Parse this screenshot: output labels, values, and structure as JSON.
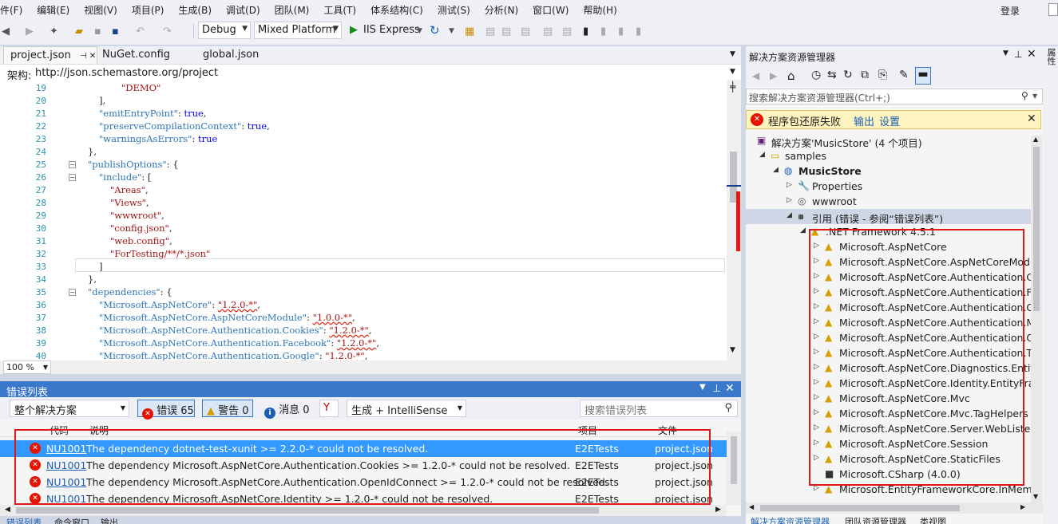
{
  "menu": [
    "件(F)",
    "编辑(E)",
    "视图(V)",
    "项目(P)",
    "生成(B)",
    "调试(D)",
    "团队(M)",
    "工具(T)",
    "体系结构(C)",
    "测试(S)",
    "分析(N)",
    "窗口(W)",
    "帮助(H)"
  ],
  "login": "登录",
  "toolbar": {
    "config": "Debug",
    "platform": "Mixed Platform",
    "run": "IIS Express"
  },
  "tabs": [
    {
      "label": "project.json",
      "active": true
    },
    {
      "label": "NuGet.config"
    },
    {
      "label": "global.json"
    }
  ],
  "schema": {
    "label": "架构:",
    "url": "http://json.schemastore.org/project"
  },
  "code_lines": [
    {
      "n": "19",
      "indent": 4,
      "parts": [
        [
          "s",
          "\"DEMO\""
        ]
      ]
    },
    {
      "n": "20",
      "indent": 2,
      "parts": [
        [
          "p",
          "],"
        ]
      ]
    },
    {
      "n": "21",
      "indent": 2,
      "parts": [
        [
          "k",
          "\"emitEntryPoint\""
        ],
        [
          "p",
          ": "
        ],
        [
          "kw",
          "true"
        ],
        [
          "p",
          ","
        ]
      ]
    },
    {
      "n": "22",
      "indent": 2,
      "parts": [
        [
          "k",
          "\"preserveCompilationContext\""
        ],
        [
          "p",
          ": "
        ],
        [
          "kw",
          "true"
        ],
        [
          "p",
          ","
        ]
      ]
    },
    {
      "n": "23",
      "indent": 2,
      "parts": [
        [
          "k",
          "\"warningsAsErrors\""
        ],
        [
          "p",
          ": "
        ],
        [
          "kw",
          "true"
        ]
      ]
    },
    {
      "n": "24",
      "indent": 1,
      "parts": [
        [
          "p",
          "},"
        ]
      ]
    },
    {
      "n": "25",
      "indent": 1,
      "fold": true,
      "parts": [
        [
          "k",
          "\"publishOptions\""
        ],
        [
          "p",
          ": {"
        ]
      ]
    },
    {
      "n": "26",
      "indent": 2,
      "fold": true,
      "parts": [
        [
          "k",
          "\"include\""
        ],
        [
          "p",
          ": ["
        ]
      ]
    },
    {
      "n": "27",
      "indent": 3,
      "parts": [
        [
          "s",
          "\"Areas\""
        ],
        [
          "p",
          ","
        ]
      ]
    },
    {
      "n": "28",
      "indent": 3,
      "parts": [
        [
          "s",
          "\"Views\""
        ],
        [
          "p",
          ","
        ]
      ]
    },
    {
      "n": "29",
      "indent": 3,
      "parts": [
        [
          "s",
          "\"wwwroot\""
        ],
        [
          "p",
          ","
        ]
      ]
    },
    {
      "n": "30",
      "indent": 3,
      "parts": [
        [
          "s",
          "\"config.json\""
        ],
        [
          "p",
          ","
        ]
      ]
    },
    {
      "n": "31",
      "indent": 3,
      "parts": [
        [
          "s",
          "\"web.config\""
        ],
        [
          "p",
          ","
        ]
      ]
    },
    {
      "n": "32",
      "indent": 3,
      "parts": [
        [
          "s",
          "\"ForTesting/**/*.json\""
        ]
      ]
    },
    {
      "n": "33",
      "indent": 2,
      "parts": [
        [
          "p",
          "]"
        ]
      ]
    },
    {
      "n": "34",
      "indent": 1,
      "parts": [
        [
          "p",
          "},"
        ]
      ]
    },
    {
      "n": "35",
      "indent": 1,
      "fold": true,
      "parts": [
        [
          "k",
          "\"dependencies\""
        ],
        [
          "p",
          ": {"
        ]
      ]
    },
    {
      "n": "36",
      "indent": 2,
      "parts": [
        [
          "k",
          "\"Microsoft.AspNetCore\""
        ],
        [
          "p",
          ": "
        ],
        [
          "sw",
          "\"1.2.0-*\""
        ],
        [
          "p",
          ","
        ]
      ]
    },
    {
      "n": "37",
      "indent": 2,
      "parts": [
        [
          "k",
          "\"Microsoft.AspNetCore.AspNetCoreModule\""
        ],
        [
          "p",
          ": "
        ],
        [
          "sw",
          "\"1.0.0-*\""
        ],
        [
          "p",
          ","
        ]
      ]
    },
    {
      "n": "38",
      "indent": 2,
      "parts": [
        [
          "k",
          "\"Microsoft.AspNetCore.Authentication.Cookies\""
        ],
        [
          "p",
          ": "
        ],
        [
          "sw",
          "\"1.2.0-*\""
        ],
        [
          "p",
          ","
        ]
      ]
    },
    {
      "n": "39",
      "indent": 2,
      "parts": [
        [
          "k",
          "\"Microsoft.AspNetCore.Authentication.Facebook\""
        ],
        [
          "p",
          ": "
        ],
        [
          "sw",
          "\"1.2.0-*\""
        ],
        [
          "p",
          ","
        ]
      ]
    },
    {
      "n": "40",
      "indent": 2,
      "parts": [
        [
          "k",
          "\"Microsoft.AspNetCore.Authentication.Google\""
        ],
        [
          "p",
          ": "
        ],
        [
          "sw",
          "\"1.2.0-*\""
        ],
        [
          "p",
          ","
        ]
      ]
    }
  ],
  "zoom": "100 %",
  "errors": {
    "title": "错误列表",
    "scope": "整个解决方案",
    "errors_btn": "错误 65",
    "warnings_btn": "警告 0",
    "messages_btn": "消息 0",
    "build_filter": "生成 + IntelliSense",
    "search_placeholder": "搜索错误列表",
    "cols": {
      "code": "代码",
      "desc": "说明",
      "project": "项目",
      "file": "文件"
    },
    "rows": [
      {
        "code": "NU1001",
        "desc": "The dependency dotnet-test-xunit >= 2.2.0-* could not be resolved.",
        "project": "E2ETests",
        "file": "project.json"
      },
      {
        "code": "NU1001",
        "desc": "The dependency Microsoft.AspNetCore.Authentication.Cookies >= 1.2.0-* could not be resolved.",
        "project": "E2ETests",
        "file": "project.json"
      },
      {
        "code": "NU1001",
        "desc": "The dependency Microsoft.AspNetCore.Authentication.OpenIdConnect >= 1.2.0-* could not be resolved.",
        "project": "E2ETests",
        "file": "project.json"
      },
      {
        "code": "NU1001",
        "desc": "The dependency Microsoft.AspNetCore.Identity >= 1.2.0-* could not be resolved.",
        "project": "E2ETests",
        "file": "project.json"
      }
    ],
    "bottom_tabs": [
      "错误列表",
      "命令窗口",
      "输出"
    ]
  },
  "solution": {
    "title": "解决方案资源管理器",
    "search_placeholder": "搜索解决方案资源管理器(Ctrl+;)",
    "warn_text": "程序包还原失败",
    "warn_output": "输出",
    "warn_settings": "设置",
    "tree": [
      {
        "label": "解决方案'MusicStore' (4 个项目)",
        "level": 0,
        "icon": "solution"
      },
      {
        "label": "samples",
        "level": 1,
        "arrow": "open",
        "icon": "folder"
      },
      {
        "label": "MusicStore",
        "level": 2,
        "arrow": "open",
        "icon": "project",
        "bold": true
      },
      {
        "label": "Properties",
        "level": 3,
        "arrow": "closed",
        "icon": "wrench"
      },
      {
        "label": "wwwroot",
        "level": 3,
        "arrow": "closed",
        "icon": "globe"
      },
      {
        "label": "引用 (错误 - 参阅“错误列表”)",
        "level": 3,
        "arrow": "open",
        "icon": "refs",
        "selected": true
      },
      {
        "label": ".NET Framework 4.5.1",
        "level": 4,
        "arrow": "open",
        "icon": "warn"
      },
      {
        "label": "Microsoft.AspNetCore",
        "level": 5,
        "arrow": "closed",
        "icon": "warn"
      },
      {
        "label": "Microsoft.AspNetCore.AspNetCoreMod",
        "level": 5,
        "arrow": "closed",
        "icon": "warn"
      },
      {
        "label": "Microsoft.AspNetCore.Authentication.Co",
        "level": 5,
        "arrow": "closed",
        "icon": "warn"
      },
      {
        "label": "Microsoft.AspNetCore.Authentication.Fa",
        "level": 5,
        "arrow": "closed",
        "icon": "warn"
      },
      {
        "label": "Microsoft.AspNetCore.Authentication.Go",
        "level": 5,
        "arrow": "closed",
        "icon": "warn"
      },
      {
        "label": "Microsoft.AspNetCore.Authentication.M",
        "level": 5,
        "arrow": "closed",
        "icon": "warn"
      },
      {
        "label": "Microsoft.AspNetCore.Authentication.Op",
        "level": 5,
        "arrow": "closed",
        "icon": "warn"
      },
      {
        "label": "Microsoft.AspNetCore.Authentication.Tw",
        "level": 5,
        "arrow": "closed",
        "icon": "warn"
      },
      {
        "label": "Microsoft.AspNetCore.Diagnostics.Entity",
        "level": 5,
        "arrow": "closed",
        "icon": "warn"
      },
      {
        "label": "Microsoft.AspNetCore.Identity.EntityFran",
        "level": 5,
        "arrow": "closed",
        "icon": "warn"
      },
      {
        "label": "Microsoft.AspNetCore.Mvc",
        "level": 5,
        "arrow": "closed",
        "icon": "warn"
      },
      {
        "label": "Microsoft.AspNetCore.Mvc.TagHelpers",
        "level": 5,
        "arrow": "closed",
        "icon": "warn"
      },
      {
        "label": "Microsoft.AspNetCore.Server.WebListen",
        "level": 5,
        "arrow": "closed",
        "icon": "warn"
      },
      {
        "label": "Microsoft.AspNetCore.Session",
        "level": 5,
        "arrow": "closed",
        "icon": "warn"
      },
      {
        "label": "Microsoft.AspNetCore.StaticFiles",
        "level": 5,
        "arrow": "closed",
        "icon": "warn"
      },
      {
        "label": "Microsoft.CSharp (4.0.0)",
        "level": 5,
        "arrow": "none",
        "icon": "ref"
      },
      {
        "label": "Microsoft.EntityFrameworkCore.InMemo",
        "level": 5,
        "arrow": "closed",
        "icon": "warn"
      }
    ],
    "bottom_tabs": [
      "解决方案资源管理器",
      "团队资源管理器",
      "类视图"
    ]
  },
  "right_strip": "属性"
}
